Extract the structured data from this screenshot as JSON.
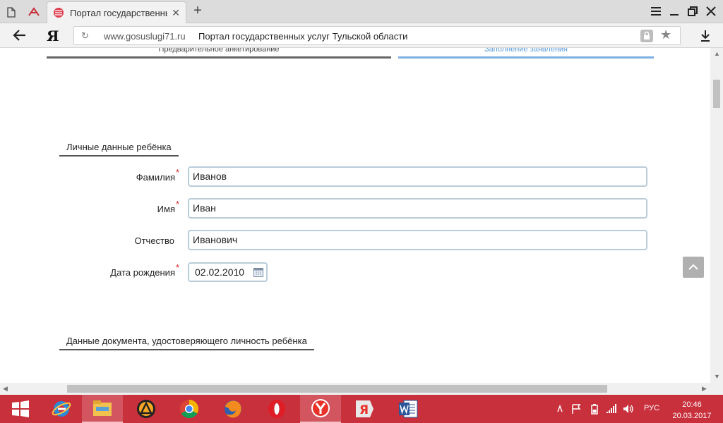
{
  "browser": {
    "tab_title": "Портал государственны",
    "url_domain": "www.gosuslugi71.ru",
    "url_title": "Портал государственных услуг Тульской области",
    "brand_letter": "Я"
  },
  "steps": {
    "step1": "Предварительное анкетирование",
    "step2": "Заполнение заявления"
  },
  "form": {
    "section1": "Личные данные ребёнка",
    "section2": "Данные документа, удостоверяющего личность ребёнка",
    "required_mark": "*",
    "fields": {
      "surname": {
        "label": "Фамилия",
        "value": "Иванов"
      },
      "name": {
        "label": "Имя",
        "value": "Иван"
      },
      "patronymic": {
        "label": "Отчество",
        "value": "Иванович"
      },
      "birthdate": {
        "label": "Дата рождения",
        "value": "02.02.2010"
      }
    }
  },
  "taskbar": {
    "lang": "РУС",
    "time": "20:46",
    "date": "20.03.2017"
  },
  "colors": {
    "taskbar": "#c8303c",
    "step_active": "#7db0e0",
    "required": "#d9262b",
    "input_border": "#b9ccd9"
  }
}
